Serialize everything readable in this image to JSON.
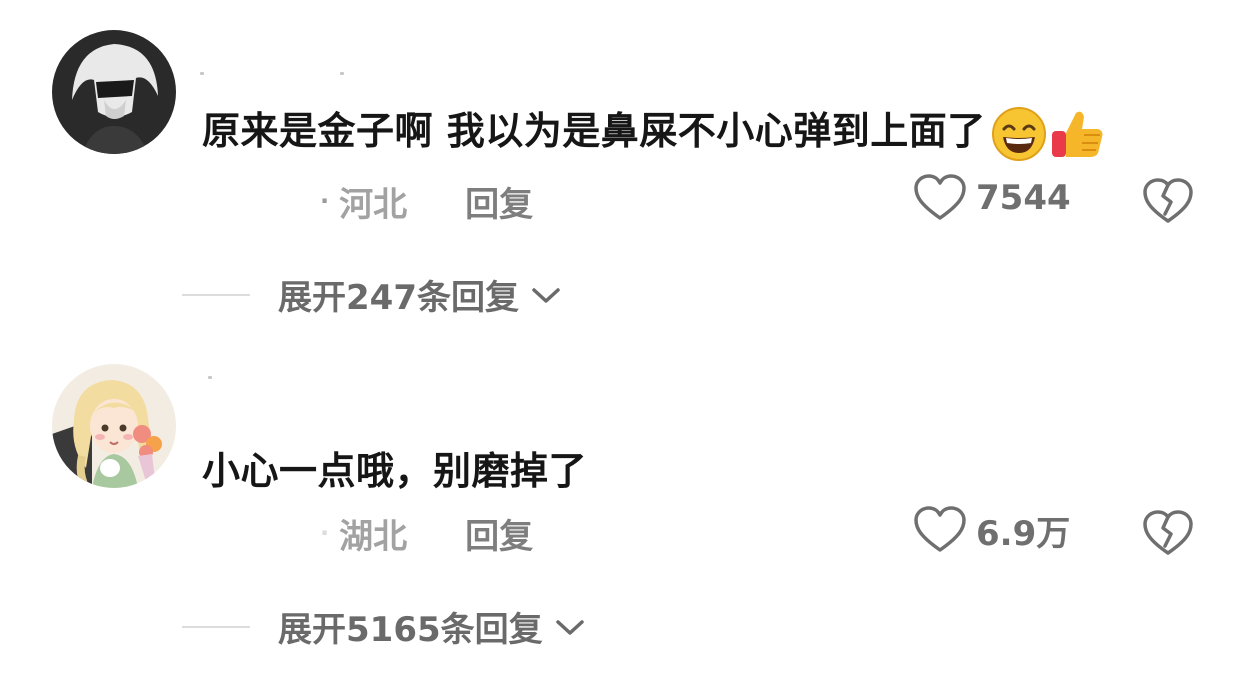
{
  "comments": [
    {
      "text": "原来是金子啊 我以为是鼻屎不小心弹到上面了",
      "emojis": [
        "grinning-face-emoji",
        "thumbs-up-emoji"
      ],
      "location": "河北",
      "reply_label": "回复",
      "like_count": "7544",
      "expand_label": "展开247条回复"
    },
    {
      "text": "小心一点哦，别磨掉了",
      "emojis": [],
      "location": "湖北",
      "reply_label": "回复",
      "like_count": "6.9万",
      "expand_label": "展开5165条回复"
    }
  ],
  "colors": {
    "text_primary": "#161616",
    "text_meta": "#a2a2a2",
    "icon": "#6f6f6f"
  }
}
